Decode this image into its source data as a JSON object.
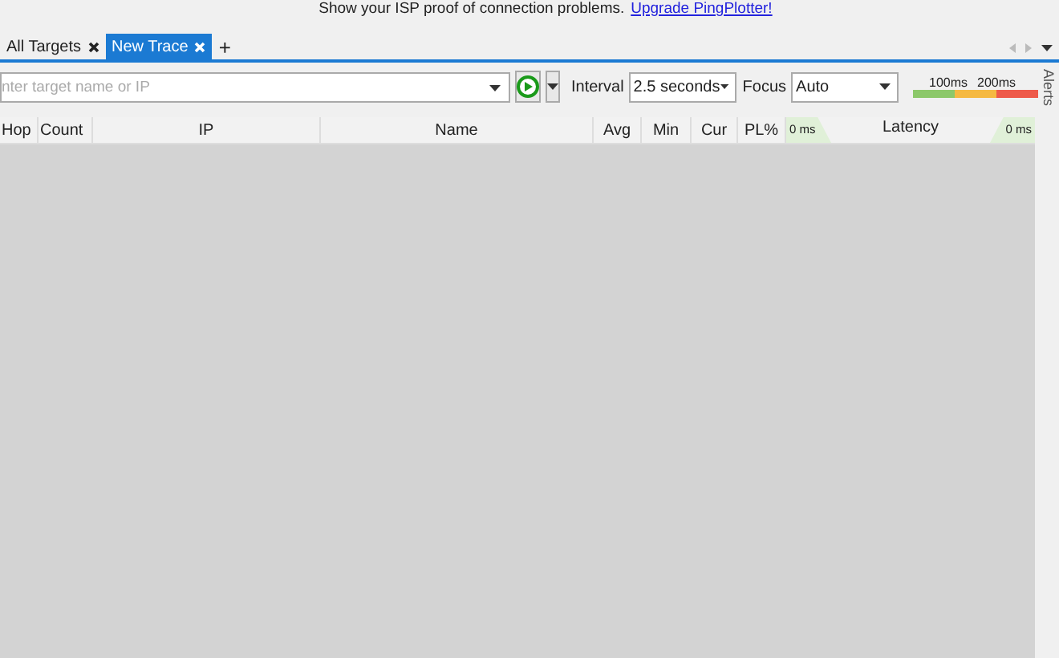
{
  "banner": {
    "text": "Show your ISP proof of connection problems.",
    "link": "Upgrade PingPlotter!"
  },
  "tabs": [
    {
      "label": "All Targets",
      "selected": false
    },
    {
      "label": "New Trace",
      "selected": true
    }
  ],
  "new_tab": "+",
  "target_field": {
    "placeholder": "nter target name or IP"
  },
  "interval": {
    "label": "Interval",
    "value": "2.5 seconds"
  },
  "focus": {
    "label": "Focus",
    "value": "Auto"
  },
  "latency_scale": [
    "100ms",
    "200ms"
  ],
  "columns": [
    "Hop",
    "Count",
    "IP",
    "Name",
    "Avg",
    "Min",
    "Cur",
    "PL%"
  ],
  "latency_column": {
    "label": "Latency",
    "min": "0 ms",
    "max": "0 ms"
  },
  "side_panel": "Alerts"
}
